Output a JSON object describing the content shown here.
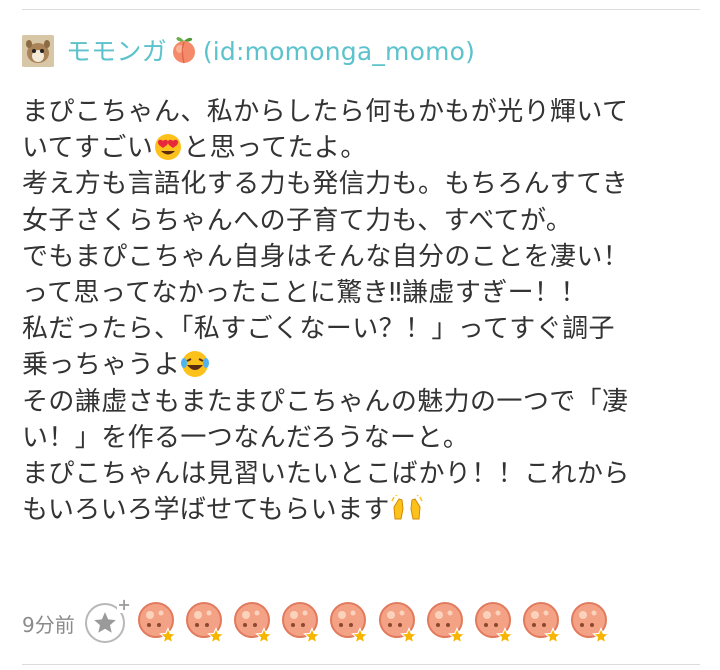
{
  "user": {
    "name": "モモンガ",
    "id_text": "(id:momonga_momo)",
    "name_emoji": "peach-emoji"
  },
  "comment": {
    "lines": [
      "まぴこちゃん、私からしたら何もかもが光り輝いて",
      "いてすごい",
      "と思ってたよ。",
      "考え方も言語化する力も発信力も。もちろんすてき",
      "女子さくらちゃんへの子育て力も、すべてが。",
      "でもまぴこちゃん自身はそんな自分のことを凄い！",
      "って思ってなかったことに驚き‼謙虚すぎー！！",
      "私だったら、「私すごくなーい？！」ってすぐ調子",
      "乗っちゃうよ",
      "その謙虚さもまたまぴこちゃんの魅力の一つで「凄",
      "い！」を作る一つなんだろうなーと。",
      "まぴこちゃんは見習いたいとこばかり！！これから",
      "もいろいろ学ばせてもらいます"
    ],
    "emojis": [
      "heart-eyes-emoji",
      "laughing-tears-emoji",
      "raised-hands-emoji"
    ]
  },
  "footer": {
    "time": "9分前",
    "add_star_icon": "star-plus-icon",
    "star_count": 10,
    "star_icon": "peach-face-with-yellow-star"
  },
  "colors": {
    "username": "#5cc2cc",
    "text": "#333333",
    "muted": "#8a8a8a",
    "star": "#f7b500"
  }
}
